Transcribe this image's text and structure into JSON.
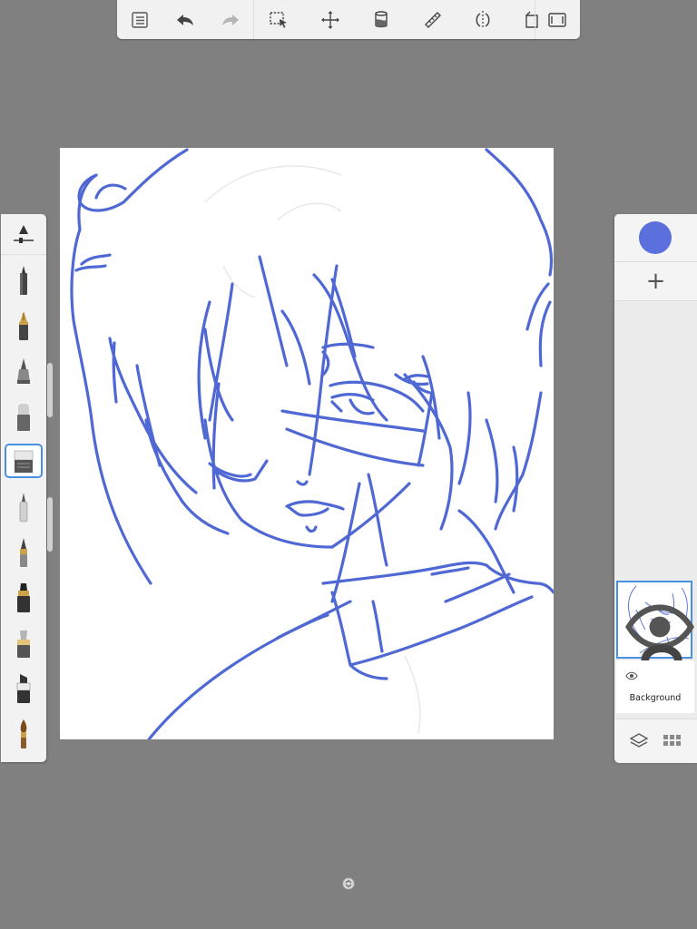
{
  "toolbar": {
    "icons": [
      {
        "name": "list-icon"
      },
      {
        "name": "undo-icon"
      },
      {
        "name": "redo-icon"
      },
      {
        "name": "selection-icon"
      },
      {
        "name": "transform-icon"
      },
      {
        "name": "fill-bucket-icon"
      },
      {
        "name": "ruler-icon"
      },
      {
        "name": "symmetry-icon"
      },
      {
        "name": "perspective-icon"
      },
      {
        "name": "fullscreen-icon"
      }
    ]
  },
  "brushes": [
    {
      "name": "brush-size-slider-icon"
    },
    {
      "name": "pencil-brush-icon"
    },
    {
      "name": "fountain-pen-brush-icon"
    },
    {
      "name": "airbrush-icon"
    },
    {
      "name": "soft-eraser-icon"
    },
    {
      "name": "eraser-icon",
      "selected": true
    },
    {
      "name": "ballpoint-pen-icon"
    },
    {
      "name": "paint-brush-tip-icon"
    },
    {
      "name": "marker-icon"
    },
    {
      "name": "highlighter-icon"
    },
    {
      "name": "chisel-marker-icon"
    },
    {
      "name": "paintbrush-icon"
    }
  ],
  "colors": {
    "current_color": "#5b70dd",
    "stroke": "#4f68d4",
    "selection": "#4a90e2"
  },
  "layers": {
    "add_label": "+",
    "items": [
      {
        "label": "",
        "visible": true,
        "locked": true
      },
      {
        "label": "Background",
        "visible": true
      }
    ]
  }
}
